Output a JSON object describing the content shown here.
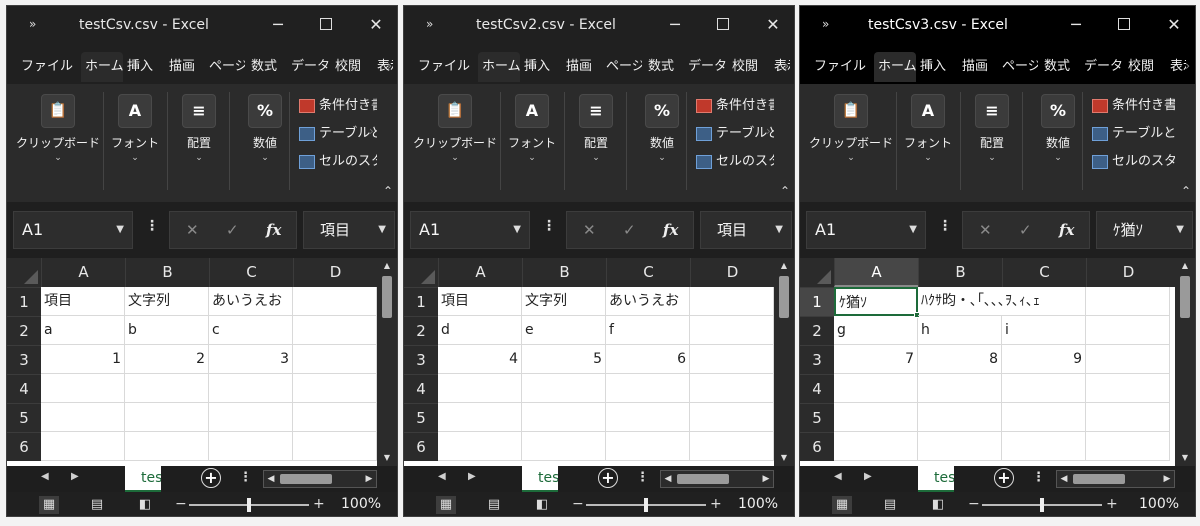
{
  "common": {
    "app_suffix": "Excel",
    "tabs": [
      "ファイル",
      "ホーム",
      "挿入",
      "描画",
      "ページ",
      "数式",
      "データ",
      "校閲",
      "表示"
    ],
    "ribbon_groups": [
      "クリップボード",
      "フォント",
      "配置",
      "数値"
    ],
    "styles_items": [
      "条件付き書式",
      "テーブルとして書式設定",
      "セルのスタイル"
    ],
    "columns": [
      "A",
      "B",
      "C",
      "D"
    ],
    "rows": [
      "1",
      "2",
      "3",
      "4",
      "5",
      "6"
    ],
    "zoom": "100%",
    "sheet_tab_partial": "tes"
  },
  "windows": [
    {
      "title": "testCsv.csv",
      "name_box": "A1",
      "formula": "項目",
      "cells": [
        [
          "項目",
          "文字列",
          "あいうえお",
          ""
        ],
        [
          "a",
          "b",
          "c",
          ""
        ],
        [
          "1",
          "2",
          "3",
          ""
        ]
      ]
    },
    {
      "title": "testCsv2.csv",
      "name_box": "A1",
      "formula": "項目",
      "cells": [
        [
          "項目",
          "文字列",
          "あいうえお",
          ""
        ],
        [
          "d",
          "e",
          "f",
          ""
        ],
        [
          "4",
          "5",
          "6",
          ""
        ]
      ]
    },
    {
      "title": "testCsv3.csv",
      "name_box": "A1",
      "formula": "ｹ猶ｿ",
      "cells": [
        [
          "ｹ猶ｿ",
          "ﾊｸｻ昀・､｢､､､ｦ､ｨ､ｪ",
          "",
          ""
        ],
        [
          "g",
          "h",
          "i",
          ""
        ],
        [
          "7",
          "8",
          "9",
          ""
        ]
      ]
    }
  ]
}
